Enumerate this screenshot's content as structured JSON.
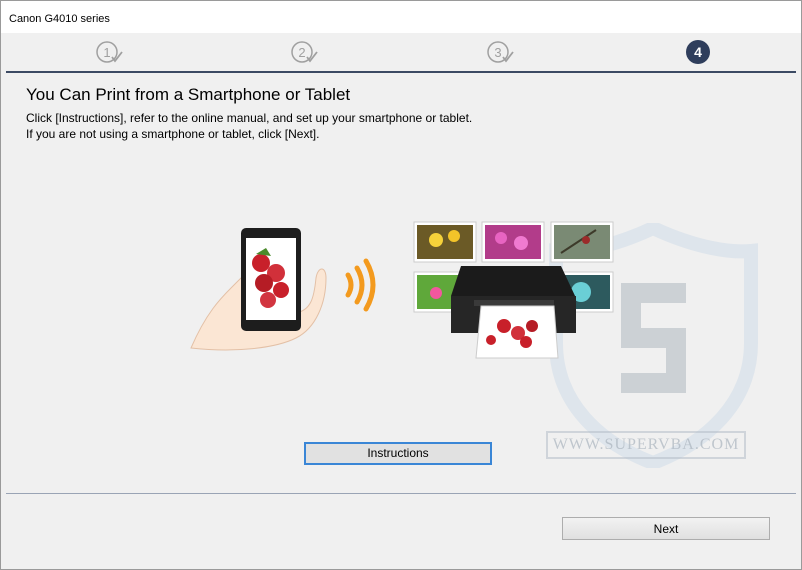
{
  "window": {
    "title": "Canon G4010 series"
  },
  "steps": [
    {
      "label": "1",
      "state": "done"
    },
    {
      "label": "2",
      "state": "done"
    },
    {
      "label": "3",
      "state": "done"
    },
    {
      "label": "4",
      "state": "active"
    }
  ],
  "main": {
    "heading": "You Can Print from a Smartphone or Tablet",
    "line1": "Click [Instructions], refer to the online manual, and set up your smartphone or tablet.",
    "line2": "If you are not using a smartphone or tablet, click [Next].",
    "instructions_label": "Instructions"
  },
  "watermark": {
    "text": "WWW.SUPERVBA.COM"
  },
  "footer": {
    "next_label": "Next"
  },
  "colors": {
    "step_active": "#2f3e5c",
    "step_line": "#3c4a63",
    "focus_border": "#3a86d6",
    "wifi_orange": "#f39a1e"
  }
}
